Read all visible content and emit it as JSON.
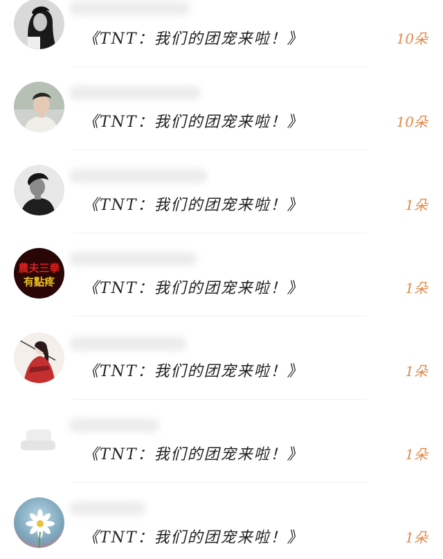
{
  "gift_list": {
    "accent_color": "#e0894a",
    "items": [
      {
        "avatar": "user-avatar-girl-icon",
        "gift": "《TNT：我们的团宠来啦！》",
        "count": "10朵"
      },
      {
        "avatar": "user-avatar-boy-icon",
        "gift": "《TNT：我们的团宠来啦！》",
        "count": "10朵"
      },
      {
        "avatar": "user-avatar-man-icon",
        "gift": "《TNT：我们的团宠来啦！》",
        "count": "1朵"
      },
      {
        "avatar": "user-avatar-text-icon",
        "avatar_text_line1": "農夫三拳",
        "avatar_text_line2": "有點疼",
        "gift": "《TNT：我们的团宠来啦！》",
        "count": "1朵"
      },
      {
        "avatar": "user-avatar-anime-icon",
        "gift": "《TNT：我们的团宠来啦！》",
        "count": "1朵"
      },
      {
        "avatar": "user-avatar-blurred-icon",
        "gift": "《TNT：我们的团宠来啦！》",
        "count": "1朵"
      },
      {
        "avatar": "user-avatar-flower-icon",
        "gift": "《TNT：我们的团宠来啦！》",
        "count": "1朵"
      }
    ]
  }
}
